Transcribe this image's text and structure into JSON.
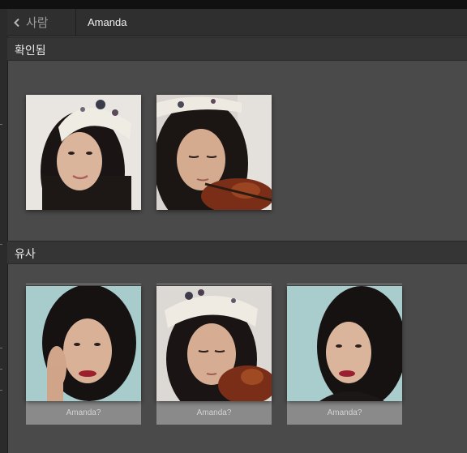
{
  "header": {
    "back_label": "사람",
    "title": "Amanda"
  },
  "sections": {
    "confirmed": {
      "label": "확인됨",
      "photos": [
        {
          "description": "woman with patterned headband, smiling"
        },
        {
          "description": "woman with headband playing violin"
        }
      ]
    },
    "similar": {
      "label": "유사",
      "photos": [
        {
          "caption": "Amanda?"
        },
        {
          "caption": "Amanda?"
        },
        {
          "caption": "Amanda?"
        }
      ]
    }
  },
  "colors": {
    "background": "#4a4a4a",
    "header_bg": "#2f2f2f",
    "section_bg": "#353535",
    "caption_bg": "#8a8a8a"
  },
  "icons": {
    "back": "chevron-left-icon"
  }
}
